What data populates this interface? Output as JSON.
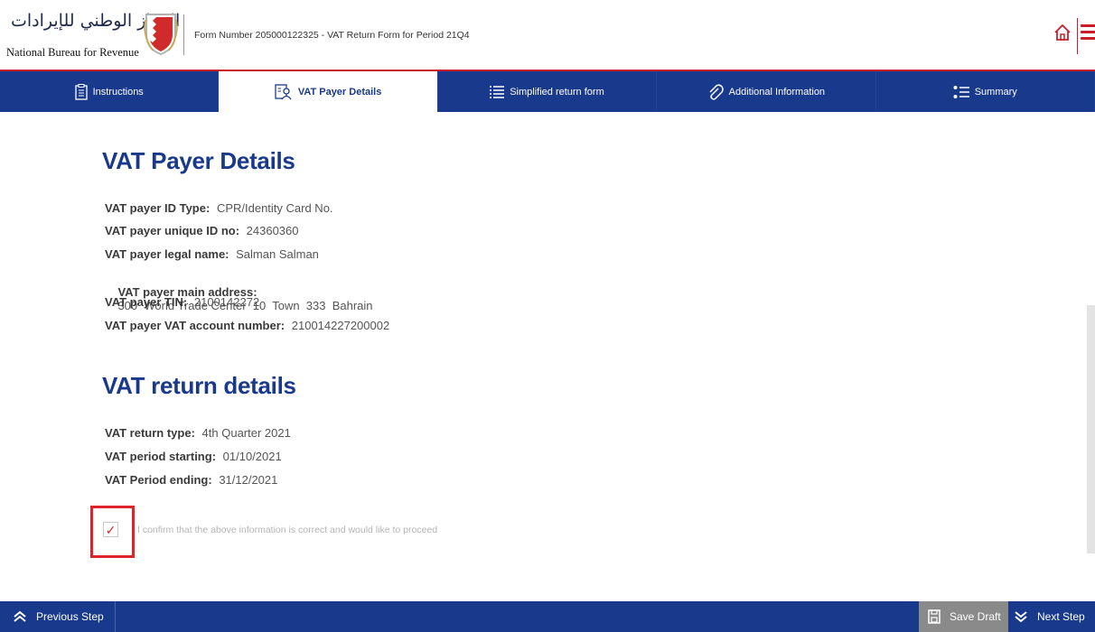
{
  "header": {
    "logo_arabic": "الجهاز الوطني للإيرادات",
    "logo_english": "National Bureau for Revenue",
    "form_title": "Form Number 205000122325 - VAT Return Form for Period 21Q4",
    "home_icon": "home-icon",
    "menu_icon": "hamburger-menu-icon",
    "accent_color": "#c81e2b"
  },
  "tabs": [
    {
      "label": "Instructions",
      "icon": "document-list-icon",
      "active": false
    },
    {
      "label": "VAT Payer Details",
      "icon": "person-card-icon",
      "active": true
    },
    {
      "label": "Simplified return form",
      "icon": "list-lines-icon",
      "active": false
    },
    {
      "label": "Additional Information",
      "icon": "paperclip-icon",
      "active": false
    },
    {
      "label": "Summary",
      "icon": "bullet-list-icon",
      "active": false
    }
  ],
  "payer_section": {
    "title": "VAT Payer Details",
    "fields": [
      {
        "label": "VAT payer ID Type:",
        "value": "CPR/Identity Card No."
      },
      {
        "label": "VAT payer unique ID no:",
        "value": "24360360"
      },
      {
        "label": "VAT payer legal name:",
        "value": "Salman Salman"
      },
      {
        "label": "VAT payer main address:",
        "value": "300  World Trade Center  10  Town  333  Bahrain"
      },
      {
        "label": "VAT payer TIN:",
        "value": "2100142272"
      },
      {
        "label": "VAT payer VAT account number:",
        "value": "210014227200002"
      }
    ]
  },
  "return_section": {
    "title": "VAT return details",
    "fields": [
      {
        "label": "VAT return type:",
        "value": "4th Quarter 2021"
      },
      {
        "label": "VAT period starting:",
        "value": "01/10/2021"
      },
      {
        "label": "VAT Period ending:",
        "value": "31/12/2021"
      }
    ]
  },
  "confirm": {
    "checked": true,
    "check_glyph": "✓",
    "text": "I confirm that the above information is correct and would like to proceed"
  },
  "footer": {
    "previous_label": "Previous Step",
    "save_label": "Save Draft",
    "next_label": "Next Step",
    "bar_color": "#193a8c"
  }
}
